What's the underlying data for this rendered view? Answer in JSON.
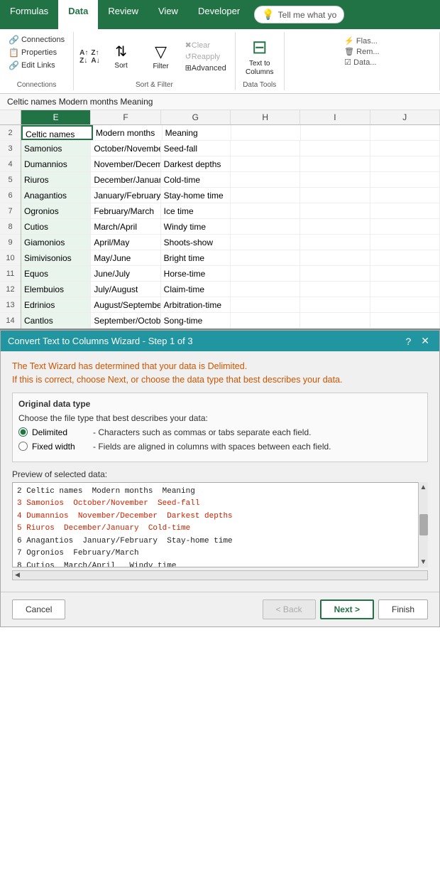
{
  "ribbon": {
    "tabs": [
      "Formulas",
      "Data",
      "Review",
      "View",
      "Developer"
    ],
    "active_tab": "Data",
    "tell_me": "Tell me what yo",
    "groups": {
      "connections": {
        "label": "Connections",
        "buttons": [
          "Connections",
          "Properties",
          "Edit Links"
        ]
      },
      "sort_filter": {
        "label": "Sort & Filter",
        "sort_label": "Sort",
        "filter_label": "Filter",
        "clear_label": "Clear",
        "reapply_label": "Reapply",
        "advanced_label": "Advanced"
      },
      "data_tools": {
        "text_to_columns_label": "Text to\nColumns"
      }
    }
  },
  "spreadsheet": {
    "formula_bar": "Celtic names Modern months Meaning",
    "col_headers": [
      "E",
      "F",
      "G",
      "H",
      "I",
      "J"
    ],
    "rows": [
      {
        "num": "",
        "cells": [
          "Celtic names",
          "Modern months",
          "Meaning",
          "",
          "",
          ""
        ]
      },
      {
        "num": "",
        "cells": [
          "Samonios",
          "October/November",
          "Seed-fall",
          "",
          "",
          ""
        ]
      },
      {
        "num": "",
        "cells": [
          "Dumannios",
          "November/December",
          "Darkest depths",
          "",
          "",
          ""
        ]
      },
      {
        "num": "",
        "cells": [
          "Riuros",
          "December/January",
          "Cold-time",
          "",
          "",
          ""
        ]
      },
      {
        "num": "",
        "cells": [
          "Anagantios",
          "January/February",
          "Stay-home time",
          "",
          "",
          ""
        ]
      },
      {
        "num": "",
        "cells": [
          "Ogronios",
          "February/March",
          "Ice time",
          "",
          "",
          ""
        ]
      },
      {
        "num": "",
        "cells": [
          "Cutios",
          "March/April",
          "Windy time",
          "",
          "",
          ""
        ]
      },
      {
        "num": "",
        "cells": [
          "Giamonios",
          "April/May",
          "Shoots-show",
          "",
          "",
          ""
        ]
      },
      {
        "num": "",
        "cells": [
          "Simivisonios",
          "May/June",
          "Bright time",
          "",
          "",
          ""
        ]
      },
      {
        "num": "",
        "cells": [
          "Equos",
          "June/July",
          "Horse-time",
          "",
          "",
          ""
        ]
      },
      {
        "num": "",
        "cells": [
          "Elembuios",
          "July/August",
          "Claim-time",
          "",
          "",
          ""
        ]
      },
      {
        "num": "",
        "cells": [
          "Edrinios",
          "August/September",
          "Arbitration-time",
          "",
          "",
          ""
        ]
      },
      {
        "num": "",
        "cells": [
          "Cantlos",
          "September/October",
          "Song-time",
          "",
          "",
          ""
        ]
      }
    ]
  },
  "dialog": {
    "title": "Convert Text to Columns Wizard - Step 1 of 3",
    "info_line1": "The Text Wizard has determined that your data is Delimited.",
    "info_line2": "If this is correct, choose Next, or choose the data type that best describes your data.",
    "original_data_type": "Original data type",
    "choose_label": "Choose the file type that best describes your data:",
    "options": [
      {
        "id": "delimited",
        "label": "Delimited",
        "desc": "- Characters such as commas or tabs separate each field.",
        "selected": true
      },
      {
        "id": "fixed_width",
        "label": "Fixed width",
        "desc": "- Fields are aligned in columns with spaces between each field.",
        "selected": false
      }
    ],
    "preview_label": "Preview of selected data:",
    "preview_rows": [
      {
        "num": "2",
        "text": "Celtic names  Modern months  Meaning",
        "highlight": false
      },
      {
        "num": "3",
        "text": "Samonios  October/November  Seed-fall",
        "highlight": true
      },
      {
        "num": "4",
        "text": "Dumannios  November/December  Darkest depths",
        "highlight": true
      },
      {
        "num": "5",
        "text": "Riuros  December/January  Cold-time",
        "highlight": true
      },
      {
        "num": "6",
        "text": "Anagantios  January/February  Stay-home time",
        "highlight": false
      },
      {
        "num": "7",
        "text": "Ogronios  February/March",
        "highlight": false
      },
      {
        "num": "8",
        "text": "Cutios  March/April   Windy time",
        "highlight": false
      }
    ],
    "buttons": {
      "cancel": "Cancel",
      "back": "< Back",
      "next": "Next >",
      "finish": "Finish"
    }
  }
}
